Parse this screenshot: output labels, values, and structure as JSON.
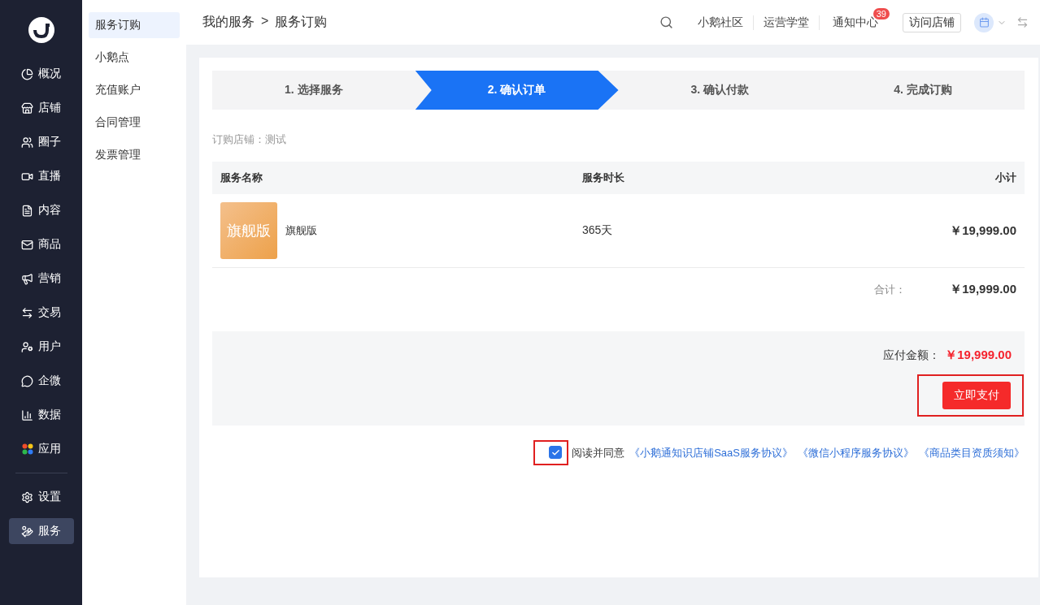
{
  "nav": {
    "items": [
      {
        "label": "概况",
        "selected": false
      },
      {
        "label": "店铺",
        "selected": false
      },
      {
        "label": "圈子",
        "selected": false
      },
      {
        "label": "直播",
        "selected": false
      },
      {
        "label": "内容",
        "selected": false
      },
      {
        "label": "商品",
        "selected": false
      },
      {
        "label": "营销",
        "selected": false
      },
      {
        "label": "交易",
        "selected": false
      },
      {
        "label": "用户",
        "selected": false
      },
      {
        "label": "企微",
        "selected": false
      },
      {
        "label": "数据",
        "selected": false
      },
      {
        "label": "应用",
        "selected": false
      }
    ],
    "bottom_items": [
      {
        "label": "设置",
        "selected": false
      },
      {
        "label": "服务",
        "selected": true
      }
    ]
  },
  "submenu": [
    {
      "label": "服务订购",
      "selected": true
    },
    {
      "label": "小鹅点",
      "selected": false
    },
    {
      "label": "充值账户",
      "selected": false
    },
    {
      "label": "合同管理",
      "selected": false
    },
    {
      "label": "发票管理",
      "selected": false
    }
  ],
  "header": {
    "breadcrumb": [
      "我的服务",
      "服务订购"
    ],
    "separator": ">",
    "links": [
      "小鹅社区",
      "运营学堂"
    ],
    "notifications": {
      "label": "通知中心",
      "badge": "39"
    },
    "visit_button": "访问店铺"
  },
  "steps": [
    {
      "label": "1. 选择服务",
      "selected": false
    },
    {
      "label": "2. 确认订单",
      "selected": true
    },
    {
      "label": "3. 确认付款",
      "selected": false
    },
    {
      "label": "4. 完成订购",
      "selected": false
    }
  ],
  "store_line": "订购店铺：测试",
  "table": {
    "columns": [
      "服务名称",
      "服务时长",
      "小计"
    ],
    "rows": [
      {
        "thumbnail": "旗舰版",
        "name": "旗舰版",
        "duration": "365天",
        "subtotal": "￥19,999.00"
      }
    ]
  },
  "total": {
    "label": "合计：",
    "value": "￥19,999.00"
  },
  "payment": {
    "label": "应付金额：",
    "value": "￥19,999.00",
    "button": "立即支付",
    "highlighted": true
  },
  "agreement": {
    "checked": true,
    "highlighted": true,
    "text": "阅读并同意",
    "links": [
      "《小鹅通知识店铺SaaS服务协议》",
      "《微信小程序服务协议》",
      "《商品类目资质须知》"
    ]
  }
}
